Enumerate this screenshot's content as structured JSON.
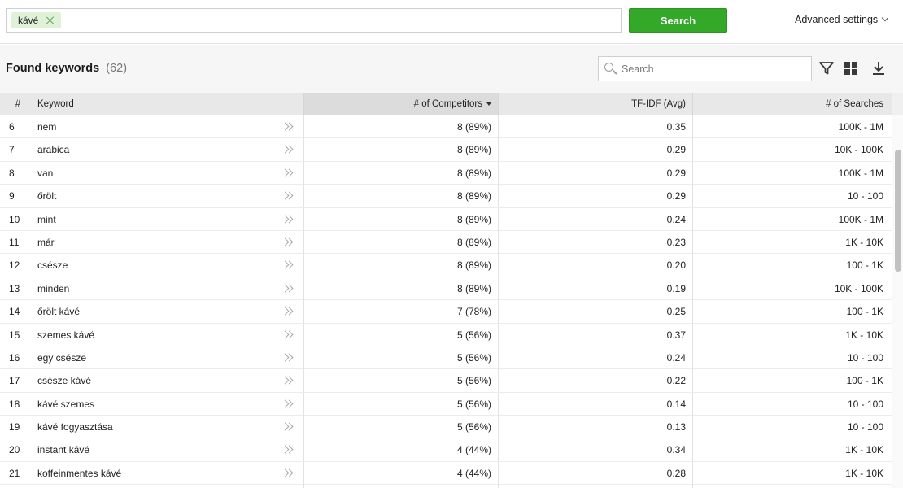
{
  "search_bar": {
    "tags": [
      {
        "label": "kávé"
      }
    ],
    "search_button_label": "Search",
    "advanced_settings_label": "Advanced settings"
  },
  "keywords_panel": {
    "title": "Found keywords",
    "count": "(62)",
    "search_placeholder": "Search",
    "icons": [
      "filter-icon",
      "grid-view-icon",
      "download-icon"
    ]
  },
  "table": {
    "headers": {
      "num": "#",
      "keyword": "Keyword",
      "competitors": "# of Competitors",
      "tfidf": "TF-IDF (Avg)",
      "searches": "# of Searches"
    },
    "sorted_column": "competitors",
    "rows": [
      {
        "num": "6",
        "keyword": "nem",
        "competitors": "8 (89%)",
        "tfidf": "0.35",
        "searches": "100K - 1M"
      },
      {
        "num": "7",
        "keyword": "arabica",
        "competitors": "8 (89%)",
        "tfidf": "0.29",
        "searches": "10K - 100K"
      },
      {
        "num": "8",
        "keyword": "van",
        "competitors": "8 (89%)",
        "tfidf": "0.29",
        "searches": "100K - 1M"
      },
      {
        "num": "9",
        "keyword": "őrölt",
        "competitors": "8 (89%)",
        "tfidf": "0.29",
        "searches": "10 - 100"
      },
      {
        "num": "10",
        "keyword": "mint",
        "competitors": "8 (89%)",
        "tfidf": "0.24",
        "searches": "100K - 1M"
      },
      {
        "num": "11",
        "keyword": "már",
        "competitors": "8 (89%)",
        "tfidf": "0.23",
        "searches": "1K - 10K"
      },
      {
        "num": "12",
        "keyword": "csésze",
        "competitors": "8 (89%)",
        "tfidf": "0.20",
        "searches": "100 - 1K"
      },
      {
        "num": "13",
        "keyword": "minden",
        "competitors": "8 (89%)",
        "tfidf": "0.19",
        "searches": "10K - 100K"
      },
      {
        "num": "14",
        "keyword": "őrölt kávé",
        "competitors": "7 (78%)",
        "tfidf": "0.25",
        "searches": "100 - 1K"
      },
      {
        "num": "15",
        "keyword": "szemes kávé",
        "competitors": "5 (56%)",
        "tfidf": "0.37",
        "searches": "1K - 10K"
      },
      {
        "num": "16",
        "keyword": "egy csésze",
        "competitors": "5 (56%)",
        "tfidf": "0.24",
        "searches": "10 - 100"
      },
      {
        "num": "17",
        "keyword": "csésze kávé",
        "competitors": "5 (56%)",
        "tfidf": "0.22",
        "searches": "100 - 1K"
      },
      {
        "num": "18",
        "keyword": "kávé szemes",
        "competitors": "5 (56%)",
        "tfidf": "0.14",
        "searches": "10 - 100"
      },
      {
        "num": "19",
        "keyword": "kávé fogyasztása",
        "competitors": "5 (56%)",
        "tfidf": "0.13",
        "searches": "10 - 100"
      },
      {
        "num": "20",
        "keyword": "instant kávé",
        "competitors": "4 (44%)",
        "tfidf": "0.34",
        "searches": "1K - 10K"
      },
      {
        "num": "21",
        "keyword": "koffeinmentes kávé",
        "competitors": "4 (44%)",
        "tfidf": "0.28",
        "searches": "1K - 10K"
      },
      {
        "num": "",
        "keyword": "",
        "competitors": "",
        "tfidf": "",
        "searches": ""
      }
    ]
  },
  "colors": {
    "primary_green": "#33a829",
    "tag_bg": "#dff2d8",
    "header_bg": "#e8e8e8",
    "panel_bg": "#f6f6f6"
  }
}
